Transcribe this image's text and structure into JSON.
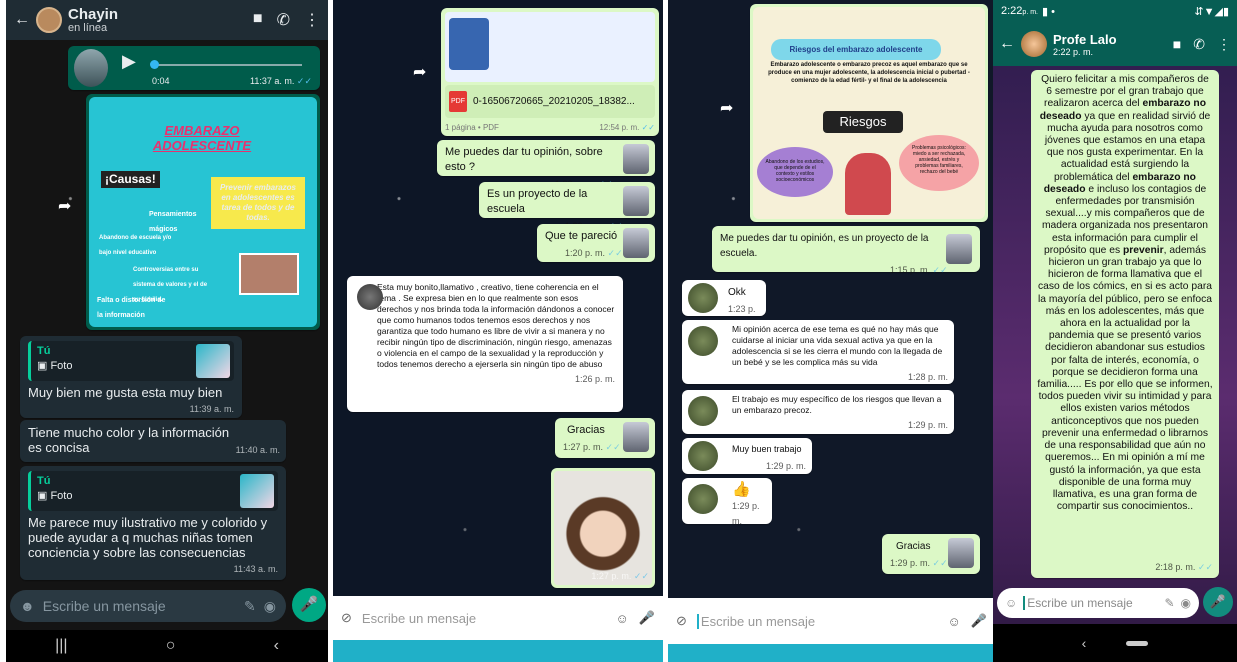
{
  "p1": {
    "contact_name": "Chayin",
    "status": "en línea",
    "audio_duration": "0:04",
    "audio_time": "11:37 a. m.",
    "poster": {
      "title_line1": "EMBARAZO",
      "title_line2": "ADOLESCENTE",
      "causas": "¡Causas!",
      "prevenir": "Prevenir embarazos en adolescentes es tarea de todos y de todas.",
      "item1": "Pensamientos mágicos",
      "item2": "Abandono de escuela y/o bajo nivel educativo",
      "item3": "Controversias entre su sistema de valores y el de su familia.",
      "item4": "Falta o distorsión de la información sexual"
    },
    "reply1": {
      "who": "Tú",
      "type": "Foto",
      "text": "Muy bien me gusta esta muy bien",
      "time": "11:39 a. m."
    },
    "msg2": {
      "text": "Tiene mucho color y la información es concisa",
      "time": "11:40 a. m."
    },
    "reply2": {
      "who": "Tú",
      "type": "Foto",
      "text": "Me parece muy ilustrativo me y colorido y puede ayudar a q muchas niñas tomen conciencia y sobre las consecuencias",
      "time": "11:43 a. m."
    },
    "input_placeholder": "Escribe un mensaje"
  },
  "p2": {
    "pdf_name": "0-16506720665_20210205_18382...",
    "pdf_meta": "1 página • PDF",
    "pdf_time": "12:54 p. m.",
    "m1": {
      "text": "Me puedes dar tu opinión, sobre esto ?",
      "time": "1:20 p. m."
    },
    "m2": {
      "text": "Es un proyecto de la escuela",
      "time": "1:20 p. m."
    },
    "m3": {
      "text": "Que te pareció",
      "time": "1:20 p. m."
    },
    "reply": {
      "text": "Esta muy bonito,llamativo , creativo, tiene coherencia en el tema . Se expresa bien en lo que realmente son esos derechos y nos brinda toda la información dándonos a conocer que como humanos todos tenemos esos derechos y nos garantiza que todo humano es libre de vivir a si manera y no recibir ningún tipo de discriminación, ningún riesgo, amenazas o violencia en el campo de la sexualidad y la reproducción y todos tenemos derecho a ejerserla sin ningún tipo de abuso",
      "time": "1:26 p. m."
    },
    "m4": {
      "text": "Gracias",
      "time": "1:27 p. m."
    },
    "photo_time": "1:27 p. m.",
    "input_placeholder": "Escribe un mensaje"
  },
  "p3": {
    "poster_title": "Riesgos del embarazo adolescente",
    "poster_text": "Embarazo adolescente o embarazo precoz es aquel embarazo que se produce en una mujer adolescente, la adolescencia inicial o pubertad -comienzo de la edad fértil- y el final de la adolescencia",
    "poster_center": "Riesgos",
    "poster_left": "Abandono de los estudios, que depende de el contexto y estilos socioeconómicos",
    "poster_right": "Problemas psicológicos: miedo a ser rechazada, ansiedad, estrés y problemas familiares, rechazo del bebé",
    "m1": {
      "text": "Me puedes dar tu opinión, es un proyecto de la escuela.",
      "time": "1:15 p. m."
    },
    "r1": {
      "text": "Okk",
      "time": "1:23 p. m."
    },
    "r2": {
      "text": "Mi opinión acerca de ese tema es qué no hay más que cuidarse al iniciar una vida sexual activa ya que en la adolescencia si se les  cierra el mundo con la llegada de un bebé y se les complica más su vida",
      "time": "1:28 p. m."
    },
    "r3": {
      "text": "El trabajo es muy específico de los riesgos que llevan a un embarazo precoz.",
      "time": "1:29 p. m."
    },
    "r4": {
      "text": "Muy buen trabajo",
      "time": "1:29 p. m."
    },
    "r5": {
      "emoji": "👍",
      "time": "1:29 p. m."
    },
    "m2": {
      "text": "Gracias",
      "time": "1:29 p. m."
    },
    "input_placeholder": "Escribe un mensaje"
  },
  "p4": {
    "clock": "2:22",
    "clock_ampm": "p. m.",
    "contact_name": "Profe Lalo",
    "contact_time": "2:22 p. m.",
    "msg_parts": [
      "Quiero felicitar a mis compañeros de 6 semestre por el gran trabajo que realizaron acerca del ",
      "embarazo no deseado",
      " ya que en realidad sirvió de mucha ayuda para nosotros como jóvenes que estamos en una etapa que nos gusta experimentar. En la actualidad  está surgiendo la problemática del ",
      "embarazo no deseado",
      " e incluso los contagios de enfermedades por transmisión sexual....y mis compañeros que de madera organizada nos presentaron esta información para cumplir el propósito que es ",
      "prevenir",
      ", además hicieron un gran trabajo ya que lo hicieron de forma llamativa que el caso de los cómics, en si es acto para la mayoría del público, pero se enfoca más en los adolescentes, más que ahora en la actualidad por la pandemia que se presentó varios decidieron abandonar sus estudios por falta de interés, economía, o porque se decidieron forma una familia..... Es por ello que se informen, todos pueden vivir su intimidad y para ellos existen varios métodos anticonceptivos que nos pueden prevenir una enfermedad o librarnos de una responsabilidad que aún no queremos... En mi opinión a mí me gustó la información, ya que esta disponible de una forma muy llamativa, es una gran forma de compartir sus conocimientos.."
    ],
    "msg_time": "2:18 p. m.",
    "input_placeholder": "Escribe un mensaje"
  }
}
